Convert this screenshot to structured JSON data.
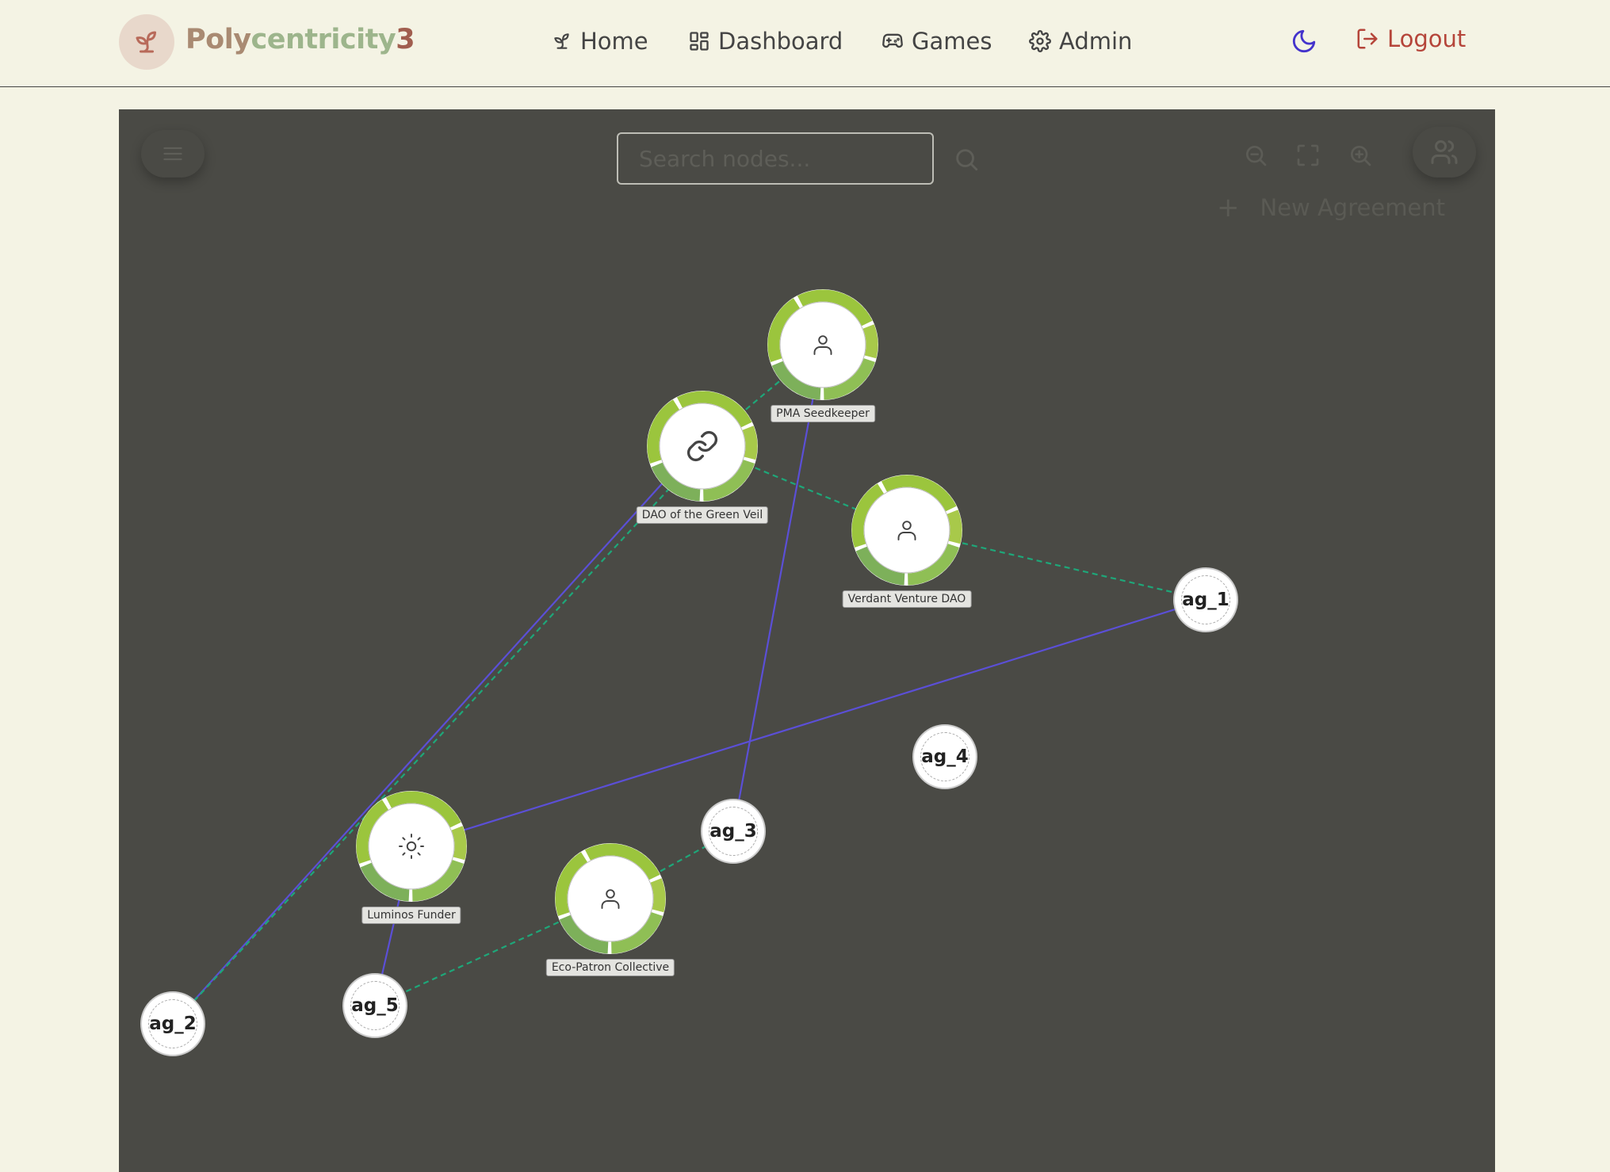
{
  "app": {
    "brand_part1": "Polycentricity",
    "brand_part2": "3"
  },
  "nav": {
    "home": "Home",
    "dashboard": "Dashboard",
    "games": "Games",
    "admin": "Admin",
    "logout": "Logout"
  },
  "toolbar": {
    "search_placeholder": "Search nodes...",
    "new_agreement": "New Agreement"
  },
  "colors": {
    "background": "#f4f3e4",
    "canvas": "#4a4a45",
    "ring_green": "#9bc53d",
    "edge_solid": "#5b4fd6",
    "edge_dashed": "#1ea779",
    "logout": "#b5453a",
    "theme_icon": "#4433cc"
  },
  "graph": {
    "actors": [
      {
        "id": "pma",
        "label": "PMA Seedkeeper",
        "icon": "user-icon"
      },
      {
        "id": "dao",
        "label": "DAO of the Green Veil",
        "icon": "link-icon"
      },
      {
        "id": "verdant",
        "label": "Verdant Venture DAO",
        "icon": "user-icon"
      },
      {
        "id": "luminos",
        "label": "Luminos Funder",
        "icon": "sun-icon"
      },
      {
        "id": "eco",
        "label": "Eco-Patron Collective",
        "icon": "user-icon"
      }
    ],
    "agreements": [
      {
        "id": "ag1",
        "label": "ag_1"
      },
      {
        "id": "ag2",
        "label": "ag_2"
      },
      {
        "id": "ag3",
        "label": "ag_3"
      },
      {
        "id": "ag4",
        "label": "ag_4"
      },
      {
        "id": "ag5",
        "label": "ag_5"
      }
    ],
    "edges": [
      {
        "from": "pma",
        "to": "dao",
        "style": "dashed"
      },
      {
        "from": "pma",
        "to": "ag3",
        "style": "solid"
      },
      {
        "from": "dao",
        "to": "verdant",
        "style": "dashed"
      },
      {
        "from": "verdant",
        "to": "ag1",
        "style": "dashed"
      },
      {
        "from": "dao",
        "to": "ag2",
        "style": "solid"
      },
      {
        "from": "dao",
        "to": "ag2",
        "style": "dashed"
      },
      {
        "from": "ag1",
        "to": "luminos",
        "style": "solid"
      },
      {
        "from": "luminos",
        "to": "ag5",
        "style": "solid"
      },
      {
        "from": "eco",
        "to": "ag5",
        "style": "dashed"
      },
      {
        "from": "eco",
        "to": "ag3",
        "style": "dashed"
      }
    ]
  }
}
